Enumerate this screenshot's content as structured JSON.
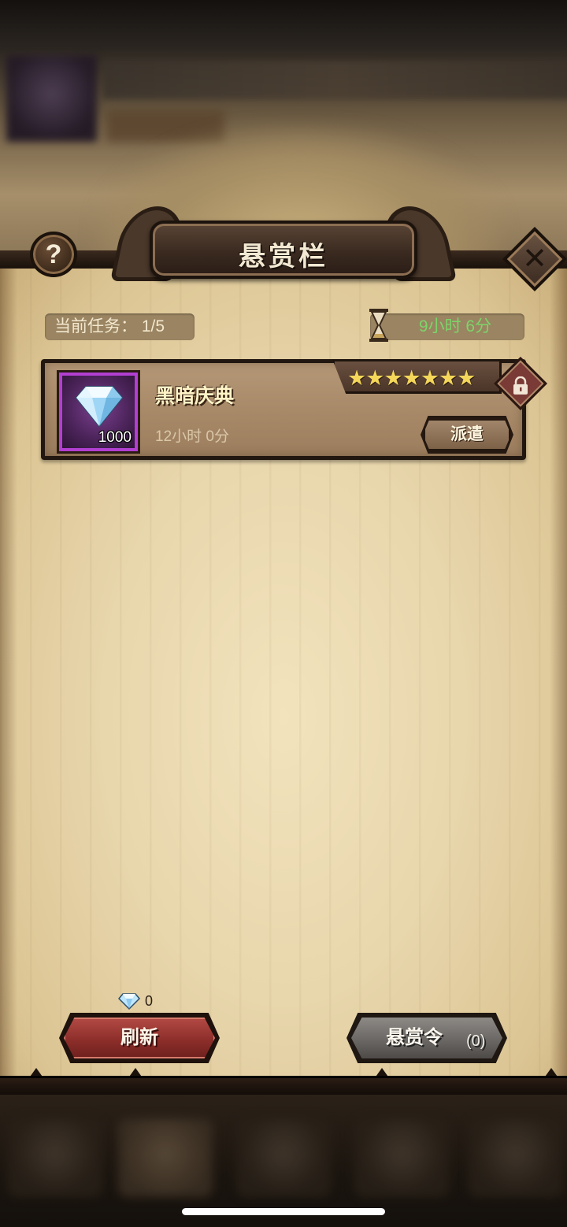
{
  "header": {
    "title": "悬赏栏",
    "help_symbol": "?",
    "close_symbol": "✕"
  },
  "info": {
    "task_count_label": "当前任务：",
    "task_count_value": "1/5",
    "timer": "9小时 6分"
  },
  "tasks": [
    {
      "name": "黑暗庆典",
      "duration": "12小时 0分",
      "reward_quantity": "1000",
      "reward_icon": "diamond-icon",
      "stars": 7,
      "stars_text": "★★★★★★★",
      "dispatch_label": "派遣",
      "locked": true
    }
  ],
  "footer": {
    "refresh_cost": "0",
    "refresh_label": "刷新",
    "bounty_label": "悬赏令",
    "bounty_count": "(0)"
  },
  "colors": {
    "timer_green": "#7dd46a",
    "rarity_purple": "#b23fd2",
    "refresh_red": "#8d2e2a",
    "star_yellow": "#f4d75a"
  }
}
